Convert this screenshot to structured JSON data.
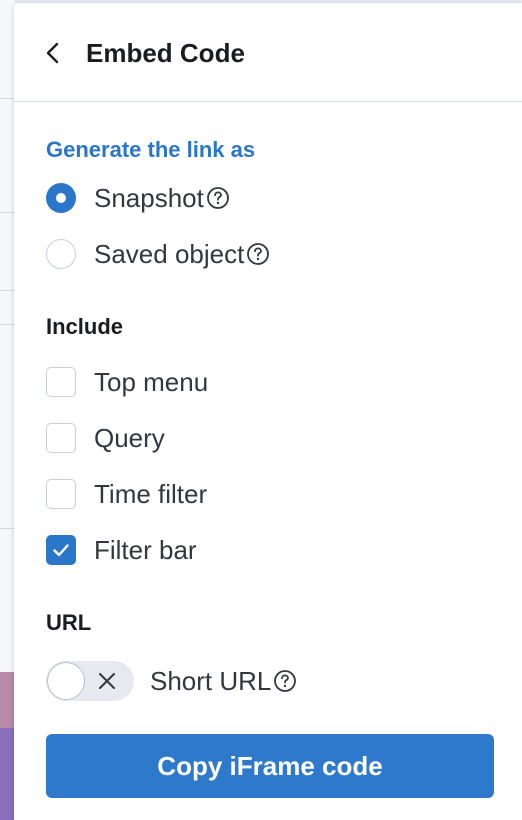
{
  "header": {
    "title": "Embed Code",
    "back_icon": "chevron-left-icon"
  },
  "link_type": {
    "heading": "Generate the link as",
    "options": [
      {
        "label": "Snapshot",
        "checked": true,
        "help_icon": "question-circle-icon"
      },
      {
        "label": "Saved object",
        "checked": false,
        "help_icon": "question-circle-icon"
      }
    ]
  },
  "include": {
    "heading": "Include",
    "options": [
      {
        "label": "Top menu",
        "checked": false
      },
      {
        "label": "Query",
        "checked": false
      },
      {
        "label": "Time filter",
        "checked": false
      },
      {
        "label": "Filter bar",
        "checked": true
      }
    ]
  },
  "url": {
    "heading": "URL",
    "short_url_label": "Short URL",
    "short_url_enabled": false,
    "help_icon": "question-circle-icon"
  },
  "actions": {
    "copy_label": "Copy iFrame code"
  },
  "colors": {
    "accent": "#2a77c9",
    "button": "#2f79cc",
    "divider": "#d3dae6"
  }
}
